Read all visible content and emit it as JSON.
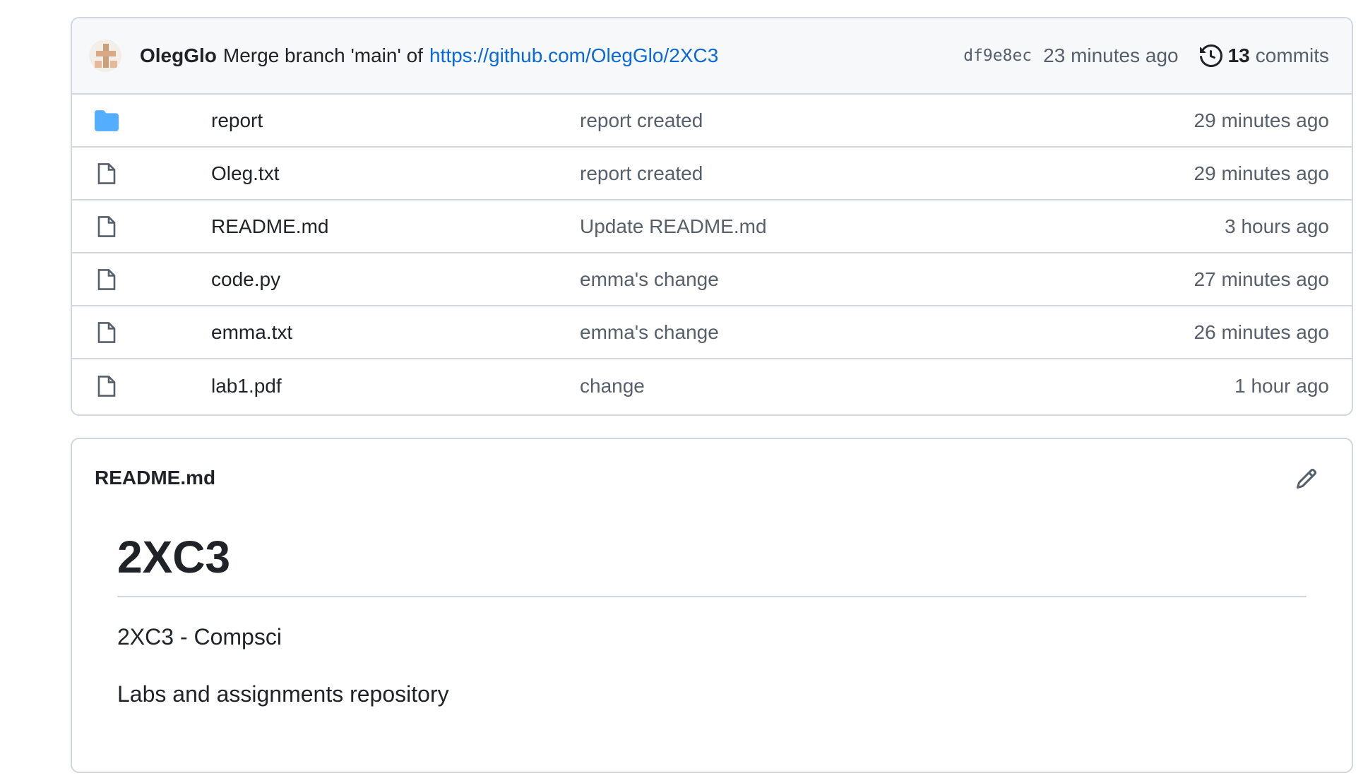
{
  "commit": {
    "author": "OlegGlo",
    "message": "Merge branch 'main' of",
    "link": "https://github.com/OlegGlo/2XC3",
    "sha": "df9e8ec",
    "time": "23 minutes ago",
    "commit_count": "13",
    "commits_label": "commits"
  },
  "files": [
    {
      "type": "folder",
      "icon": "folder-icon",
      "name": "report",
      "message": "report created",
      "time": "29 minutes ago"
    },
    {
      "type": "file",
      "icon": "file-icon",
      "name": "Oleg.txt",
      "message": "report created",
      "time": "29 minutes ago"
    },
    {
      "type": "file",
      "icon": "file-icon",
      "name": "README.md",
      "message": "Update README.md",
      "time": "3 hours ago"
    },
    {
      "type": "file",
      "icon": "file-icon",
      "name": "code.py",
      "message": "emma's change",
      "time": "27 minutes ago"
    },
    {
      "type": "file",
      "icon": "file-icon",
      "name": "emma.txt",
      "message": "emma's change",
      "time": "26 minutes ago"
    },
    {
      "type": "file",
      "icon": "file-icon",
      "name": "lab1.pdf",
      "message": "change",
      "time": "1 hour ago"
    }
  ],
  "readme": {
    "filename": "README.md",
    "heading": "2XC3",
    "paragraphs": [
      "2XC3 - Compsci",
      "Labs and assignments repository"
    ]
  },
  "colors": {
    "link": "#0969da",
    "folder": "#54aeff",
    "border": "#d0d7de",
    "muted": "#57606a"
  }
}
